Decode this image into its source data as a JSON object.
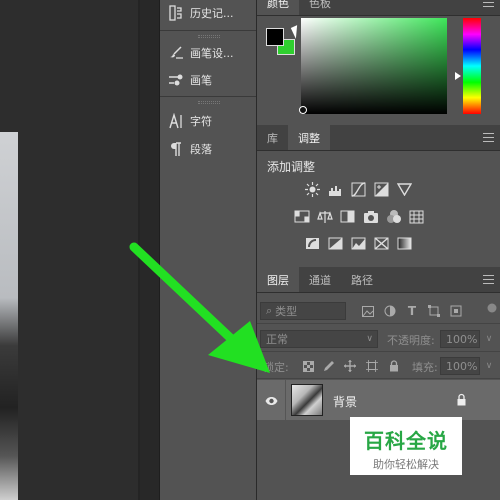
{
  "mid_dock": {
    "items": [
      {
        "label": "历史记...",
        "icon": "history-icon"
      },
      {
        "label": "画笔设...",
        "icon": "brush-settings-icon"
      },
      {
        "label": "画笔",
        "icon": "brush-icon"
      },
      {
        "label": "字符",
        "icon": "character-icon"
      },
      {
        "label": "段落",
        "icon": "paragraph-icon"
      }
    ]
  },
  "color_panel": {
    "tabs": [
      "颜色",
      "色板"
    ],
    "foreground": "#000000",
    "background": "#2fd02f"
  },
  "adjustments_panel": {
    "tabs": [
      "库",
      "调整"
    ],
    "title": "添加调整"
  },
  "layers_panel": {
    "tabs": [
      "图层",
      "通道",
      "路径"
    ],
    "filter_placeholder": "类型",
    "blend_mode": "正常",
    "opacity_label": "不透明度:",
    "opacity_value": "100%",
    "lock_label": "锁定:",
    "fill_label": "填充:",
    "fill_value": "100%",
    "layer": {
      "name": "背景"
    }
  },
  "watermark": {
    "title": "百科全说",
    "subtitle": "助你轻松解决"
  },
  "colors": {
    "panel_bg": "#535353",
    "tabbar_bg": "#424242",
    "arrow_green": "#22e022"
  }
}
